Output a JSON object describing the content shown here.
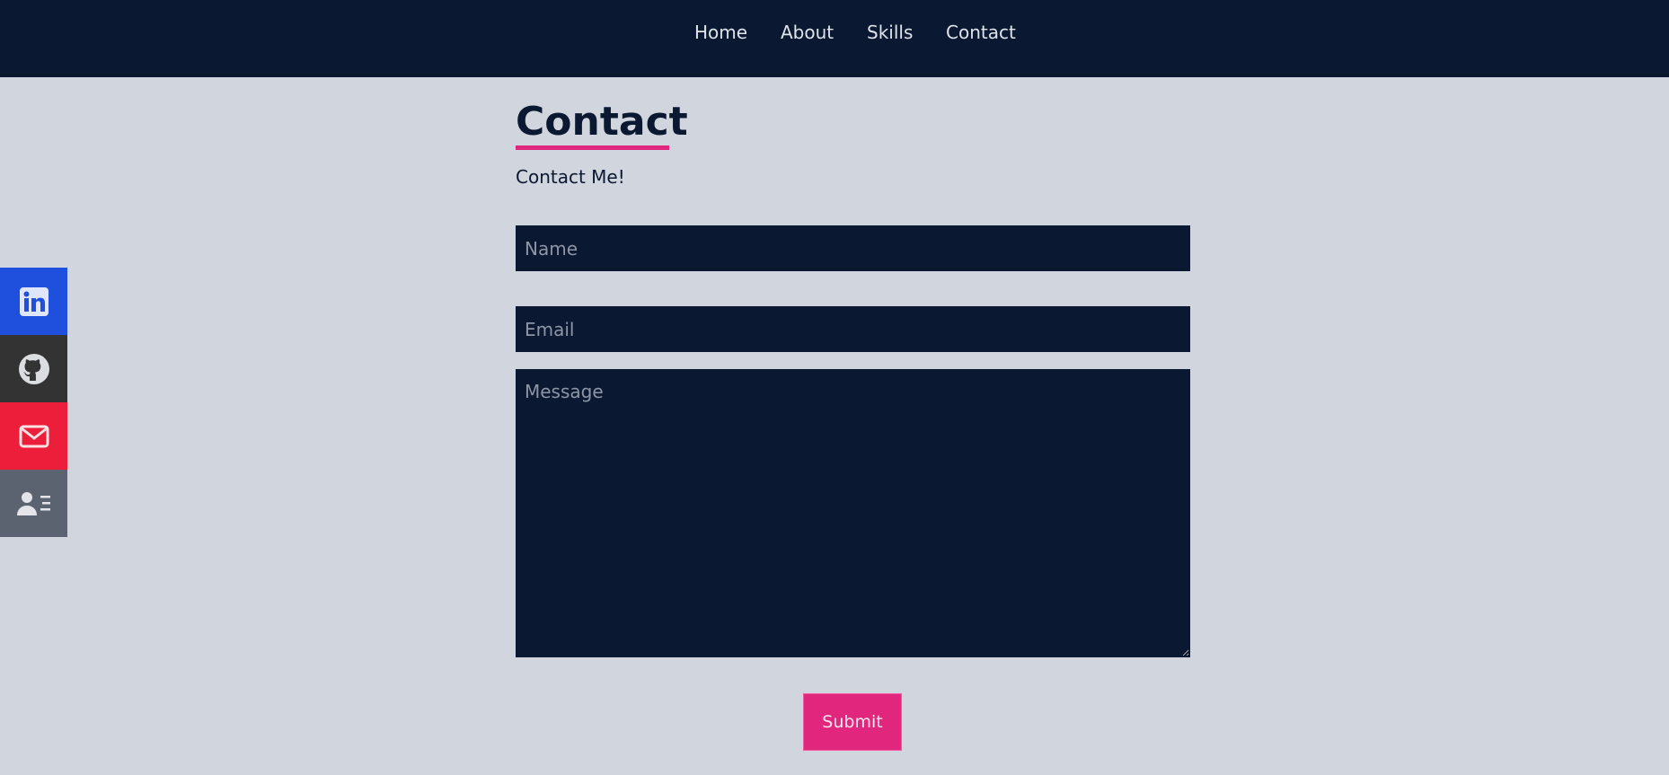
{
  "nav": {
    "items": [
      {
        "label": "Home"
      },
      {
        "label": "About"
      },
      {
        "label": "Skills"
      },
      {
        "label": "Contact"
      }
    ]
  },
  "social": {
    "items": [
      {
        "icon": "linkedin-icon",
        "color": "#1f4fdd"
      },
      {
        "icon": "github-icon",
        "color": "#333333"
      },
      {
        "icon": "envelope-icon",
        "color": "#ed1e3a"
      },
      {
        "icon": "person-card-icon",
        "color": "#5b6270"
      }
    ]
  },
  "contact": {
    "title": "Contact",
    "subtitle": "Contact Me!",
    "name_placeholder": "Name",
    "email_placeholder": "Email",
    "message_placeholder": "Message",
    "submit_label": "Submit"
  },
  "colors": {
    "navbar": "#0a1931",
    "page_background": "#d1d5de",
    "accent": "#e0267d",
    "field_background": "#0a1931"
  }
}
